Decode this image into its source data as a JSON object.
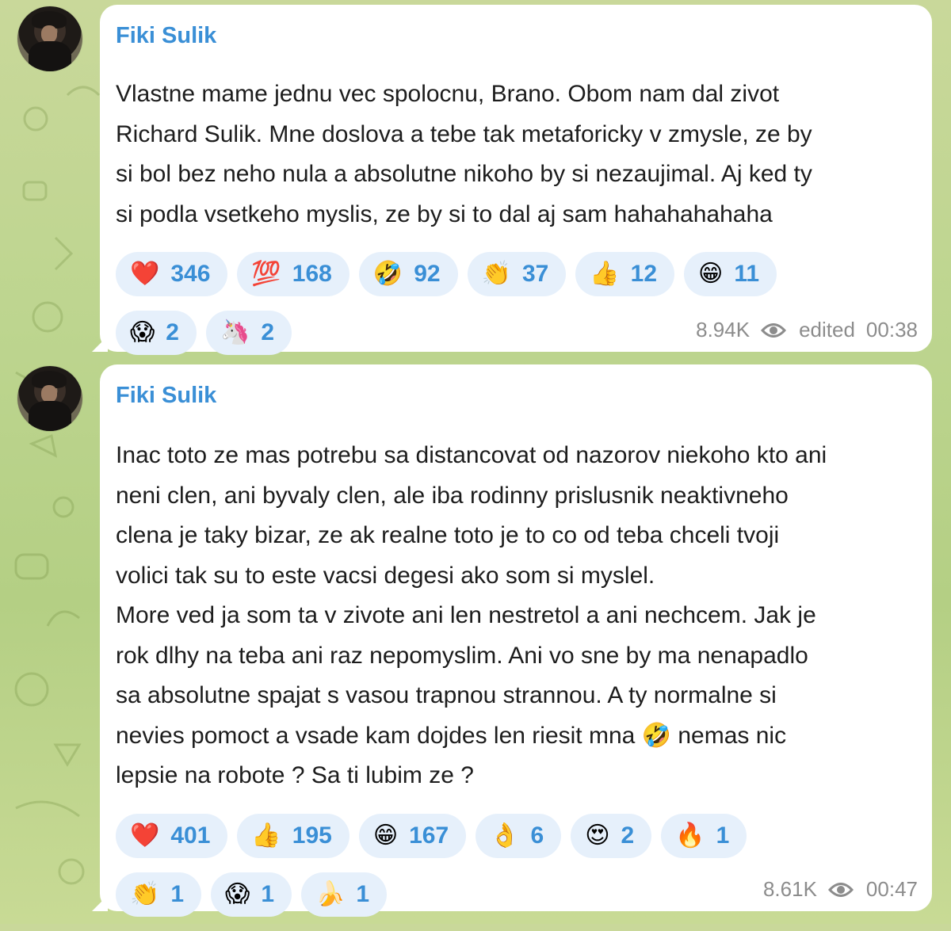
{
  "messages": [
    {
      "author": "Fiki Sulik",
      "text": "Vlastne mame jednu vec spolocnu, Brano. Obom nam dal zivot\nRichard Sulik. Mne doslova a tebe tak metaforicky v zmysle, ze by\nsi bol bez neho nula a absolutne nikoho by si nezaujimal. Aj ked ty\nsi podla vsetkeho myslis, ze by si to dal aj sam hahahahahaha",
      "reactions": [
        {
          "emoji": "❤️",
          "icon": "heart-icon",
          "count": "346"
        },
        {
          "emoji": "💯",
          "icon": "hundred-points-icon",
          "count": "168"
        },
        {
          "emoji": "🤣",
          "icon": "rofl-icon",
          "count": "92"
        },
        {
          "emoji": "👏",
          "icon": "clapping-hands-icon",
          "count": "37"
        },
        {
          "emoji": "👍",
          "icon": "thumbs-up-icon",
          "count": "12"
        },
        {
          "emoji": "😁",
          "icon": "grinning-face-icon",
          "count": "11"
        },
        {
          "emoji": "😱",
          "icon": "screaming-face-icon",
          "count": "2"
        },
        {
          "emoji": "🦄",
          "icon": "unicorn-icon",
          "count": "2"
        }
      ],
      "views": "8.94K",
      "edited_label": "edited",
      "time": "00:38"
    },
    {
      "author": "Fiki Sulik",
      "text": "Inac toto ze mas potrebu sa distancovat od nazorov niekoho kto ani\nneni clen, ani byvaly clen, ale iba rodinny prislusnik neaktivneho\nclena je taky bizar, ze ak realne toto je to co od teba chceli tvoji\nvolici tak su to este vacsi degesi ako som si myslel.\nMore ved ja som ta v zivote ani len nestretol a ani nechcem. Jak je\nrok dlhy na teba ani raz nepomyslim. Ani vo sne by ma nenapadlo\nsa absolutne spajat s vasou trapnou strannou. A ty normalne si\nnevies pomoct a vsade kam dojdes len riesit mna 🤣 nemas nic\nlepsie na robote ? Sa ti lubim ze ?",
      "reactions": [
        {
          "emoji": "❤️",
          "icon": "heart-icon",
          "count": "401"
        },
        {
          "emoji": "👍",
          "icon": "thumbs-up-icon",
          "count": "195"
        },
        {
          "emoji": "😁",
          "icon": "grinning-face-icon",
          "count": "167"
        },
        {
          "emoji": "👌",
          "icon": "ok-hand-icon",
          "count": "6"
        },
        {
          "emoji": "😍",
          "icon": "heart-eyes-icon",
          "count": "2"
        },
        {
          "emoji": "🔥",
          "icon": "fire-icon",
          "count": "1"
        },
        {
          "emoji": "👏",
          "icon": "clapping-hands-icon",
          "count": "1"
        },
        {
          "emoji": "😱",
          "icon": "screaming-face-icon",
          "count": "1"
        },
        {
          "emoji": "🍌",
          "icon": "banana-icon",
          "count": "1"
        }
      ],
      "views": "8.61K",
      "edited_label": "",
      "time": "00:47"
    }
  ],
  "theme": {
    "accent": "#3a8fd6",
    "reaction_bg": "#e6f0fb",
    "meta_color": "#8c8c8c"
  }
}
